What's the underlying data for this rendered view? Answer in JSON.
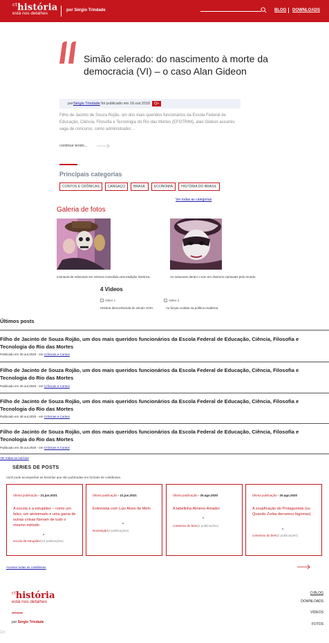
{
  "header": {
    "brand_prefix": "ct",
    "brand": "história",
    "tagline": "está nos detalhes",
    "author": "por Sérgio Trindade",
    "nav": [
      "BLOG",
      "DOWNLOADS"
    ]
  },
  "hero": {
    "title": "Simão celerado: do nascimento à morte da democracia (VI) – o caso Alan Gideon",
    "meta_prefix": "por",
    "meta_author": "Sérgio Trindade",
    "meta_suffix": " foi publicado em 16.out.2018",
    "meta_tag": "Q+",
    "excerpt": "Filho de Jacinto de Souza Rojão, um dos mais queridos funcionários da Escola Federal de Educação, Ciência, Filosofia e Tecnologia do Rio das Mortes (EFOTRIM), alan Gideon assumiu vaga de concurso, como administrador...",
    "continue": "continue lendo..."
  },
  "categories": {
    "title": "Principais categorias",
    "items": [
      "CONTOS E CRÔNICAS",
      "CANGAÇO",
      "BRASIL",
      "ECONOMIA",
      "HISTÓRIA DO BRASIL"
    ],
    "see_all": "Ver todas as categorias"
  },
  "gallery": {
    "title": "Galeria de fotos",
    "captions": [
      "Carnaval de máscaras em Veneza consolida uma tradição histórica.",
      "As máscaras deram o tom em diversos carnavais pelo mundo."
    ]
  },
  "videos": {
    "title": "4 Videos",
    "items": [
      {
        "alt": "Video 1",
        "caption": "História desconhecida do século XVIII."
      },
      {
        "alt": "Video 2",
        "caption": "As forças ocultas na política moderna."
      }
    ]
  },
  "latest": {
    "title": "Últimos posts",
    "posts": [
      {
        "title": "Filho de Jacinto de Souza Rojão, um dos mais queridos funcionários da Escola Federal de Educação, Ciência, Filosofia e Tecnologia do Rio das Mortes",
        "meta": "Publicado em 30.out.2020 - em ",
        "category": "Crônicas e Contos"
      },
      {
        "title": "Filho de Jacinto de Souza Rojão, um dos mais queridos funcionários da Escola Federal de Educação, Ciência, Filosofia e Tecnologia do Rio das Mortes",
        "meta": "Publicado em 30.out.2020 - em ",
        "category": "Crônicas e Contos"
      },
      {
        "title": "Filho de Jacinto de Souza Rojão, um dos mais queridos funcionários da Escola Federal de Educação, Ciência, Filosofia e Tecnologia do Rio das Mortes",
        "meta": "Publicado em 30.out.2020 - em ",
        "category": "Crônicas e Contos"
      },
      {
        "title": "Filho de Jacinto de Souza Rojão, um dos mais queridos funcionários da Escola Federal de Educação, Ciência, Filosofia e Tecnologia do Rio das Mortes",
        "meta": "Publicado em 30.out.2020 - em ",
        "category": "Crônicas e Contos"
      }
    ],
    "see_all": "Ver todas as notícias"
  },
  "series": {
    "title": "SÉRIES DE POSTS",
    "desc": "Você pode acompanhar as histórias que são publicadas em formato de coletâneas.",
    "last_label": "Última publicação",
    "cards": [
      {
        "date": " - 21.jun.2021",
        "title": "A escola e a estupidez – como um falso, um atoleimado e uma gama de outras coisas fizeram de tudo o mesmo método",
        "foot": "escola da estupidez",
        "count": "(10 publicações)"
      },
      {
        "date": " - 21.jun.2021",
        "title": "Entrevista com Luiz Alves de Melo",
        "foot": "Nomeação",
        "count": "(3 publicações)"
      },
      {
        "date": " - 20.ago.2020",
        "title": "A tabelinha Almeno-Amador",
        "foot": "consenso do bem",
        "count": "(2 publicações)"
      },
      {
        "date": " - 20.ago.2020",
        "title": "A zoopficação do Protagonista (ou Quando Zorba derramou lágrimas)",
        "foot": "consenso do bem",
        "count": "(2 publicações)"
      }
    ],
    "see_all": "Acessar todas as coletâneas"
  },
  "footer": {
    "brand_prefix": "ct",
    "brand": "história",
    "tagline": "está nos detalhes",
    "author_prefix": "por ",
    "author": "Sérgio Trindade",
    "nav": [
      "O BLOG",
      "DOWNLOADS",
      "VIDEOS",
      "FOTOS"
    ],
    "corner": "Dn"
  },
  "colors": {
    "brand_red": "#c4161c",
    "link": "#1a1aa6"
  }
}
